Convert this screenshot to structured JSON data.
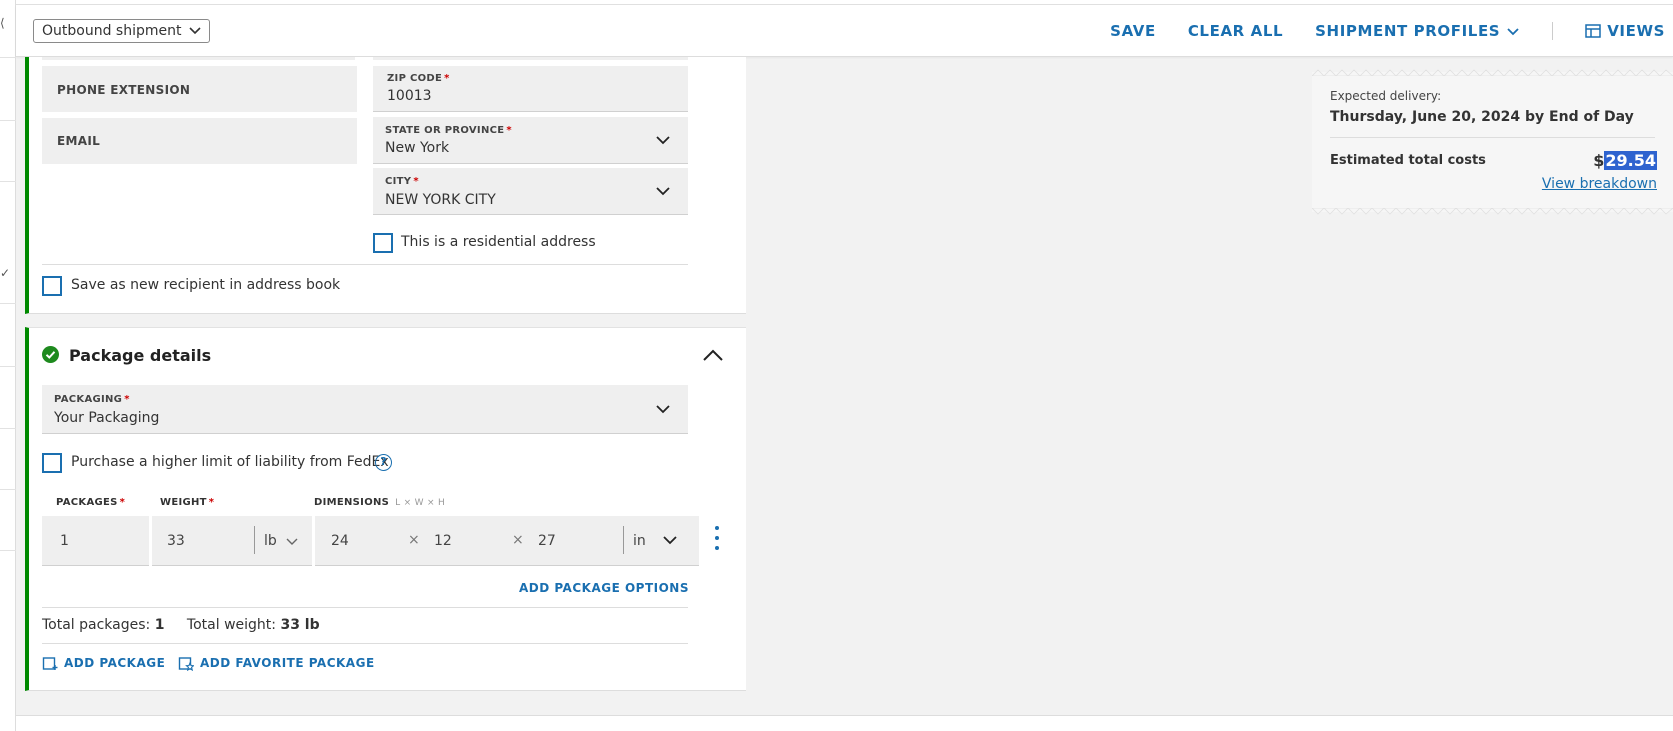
{
  "topbar": {
    "shipment_type": "Outbound shipment",
    "save": "SAVE",
    "clear_all": "CLEAR ALL",
    "shipment_profiles": "SHIPMENT PROFILES",
    "views": "VIEWS"
  },
  "recipient": {
    "phone_extension_label": "PHONE EXTENSION",
    "email_label": "EMAIL",
    "zip": {
      "label": "ZIP CODE",
      "required": "*",
      "value": "10013"
    },
    "state": {
      "label": "STATE OR PROVINCE",
      "required": "*",
      "value": "New York"
    },
    "city": {
      "label": "CITY",
      "required": "*",
      "value": "NEW YORK CITY"
    },
    "residential_label": "This is a residential address",
    "save_recipient_label": "Save as new recipient in address book"
  },
  "package_details": {
    "title": "Package details",
    "packaging": {
      "label": "PACKAGING",
      "required": "*",
      "value": "Your Packaging"
    },
    "liability_label": "Purchase a higher limit of liability from FedEx",
    "help_glyph": "?",
    "columns": {
      "packages": "PACKAGES",
      "weight": "WEIGHT",
      "dimensions": "DIMENSIONS",
      "dimensions_hint": "L × W × H",
      "required": "*"
    },
    "row": {
      "packages": "1",
      "weight": "33",
      "weight_unit": "lb",
      "length": "24",
      "width": "12",
      "height": "27",
      "dim_unit": "in",
      "times": "×"
    },
    "add_package_options": "ADD PACKAGE OPTIONS",
    "total_packages_label": "Total packages:",
    "total_packages_value": "1",
    "total_weight_label": "Total weight:",
    "total_weight_value": "33 lb",
    "add_package": "ADD PACKAGE",
    "add_favorite_package": "ADD FAVORITE PACKAGE"
  },
  "summary": {
    "expected_label": "Expected delivery:",
    "expected_date": "Thursday, June 20, 2024 by End of Day",
    "estimated_label": "Estimated total costs",
    "currency": "$",
    "amount": "29.54",
    "view_breakdown": "View breakdown"
  },
  "colors": {
    "accent_blue": "#1a6fb0",
    "success_green": "#008a00",
    "selection_blue": "#2e63cf"
  }
}
